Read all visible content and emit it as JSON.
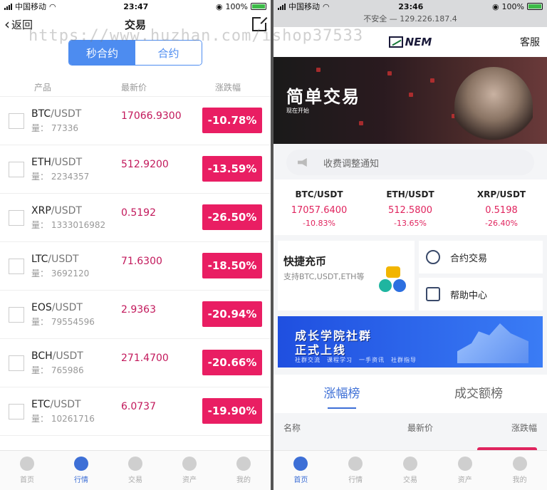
{
  "left": {
    "status": {
      "carrier": "中国移动",
      "time": "23:47",
      "battery": "100%"
    },
    "nav": {
      "back_label": "返回",
      "title": "交易"
    },
    "segment": {
      "tabs": [
        "秒合约",
        "合约"
      ],
      "active": 0
    },
    "table_header": [
      "产品",
      "最新价",
      "涨跌幅"
    ],
    "rows": [
      {
        "base": "BTC",
        "quote": "/USDT",
        "volume": "量： 77336",
        "price": "17066.9300",
        "change": "-10.78%"
      },
      {
        "base": "ETH",
        "quote": "/USDT",
        "volume": "量： 2234357",
        "price": "512.9200",
        "change": "-13.59%"
      },
      {
        "base": "XRP",
        "quote": "/USDT",
        "volume": "量： 1333016982",
        "price": "0.5192",
        "change": "-26.50%"
      },
      {
        "base": "LTC",
        "quote": "/USDT",
        "volume": "量： 3692120",
        "price": "71.6300",
        "change": "-18.50%"
      },
      {
        "base": "EOS",
        "quote": "/USDT",
        "volume": "量： 79554596",
        "price": "2.9363",
        "change": "-20.94%"
      },
      {
        "base": "BCH",
        "quote": "/USDT",
        "volume": "量： 765986",
        "price": "271.4700",
        "change": "-20.66%"
      },
      {
        "base": "ETC",
        "quote": "/USDT",
        "volume": "量： 10261716",
        "price": "6.0737",
        "change": "-19.90%"
      }
    ],
    "tabbar": [
      "首页",
      "行情",
      "交易",
      "资产",
      "我的"
    ],
    "tabbar_active": 1
  },
  "watermark": "https://www.huzhan.com/ishop37533",
  "right": {
    "status": {
      "carrier": "中国移动",
      "time": "23:46",
      "battery": "100%"
    },
    "url": "不安全 — 129.226.187.4",
    "logo": "NEM",
    "service": "客服",
    "banner": {
      "title": "简单交易",
      "subtitle": "现在开始"
    },
    "notice": "收费调整通知",
    "tickers": [
      {
        "pair": "BTC/USDT",
        "price": "17057.6400",
        "change": "-10.83%"
      },
      {
        "pair": "ETH/USDT",
        "price": "512.5800",
        "change": "-13.65%"
      },
      {
        "pair": "XRP/USDT",
        "price": "0.5198",
        "change": "-26.40%"
      }
    ],
    "recharge": {
      "title": "快捷充币",
      "desc": "支持BTC,USDT,ETH等"
    },
    "links": [
      "合约交易",
      "帮助中心"
    ],
    "ad": {
      "line1": "成长学院社群",
      "line2": "正式上线",
      "line3": "社群交流　课程学习　一手资讯　社群指导"
    },
    "rank_tabs": [
      "涨幅榜",
      "成交额榜"
    ],
    "rank_active": 0,
    "rank_header": [
      "名称",
      "最新价",
      "涨跌幅"
    ],
    "tabbar": [
      "首页",
      "行情",
      "交易",
      "资产",
      "我的"
    ],
    "tabbar_active": 0
  }
}
